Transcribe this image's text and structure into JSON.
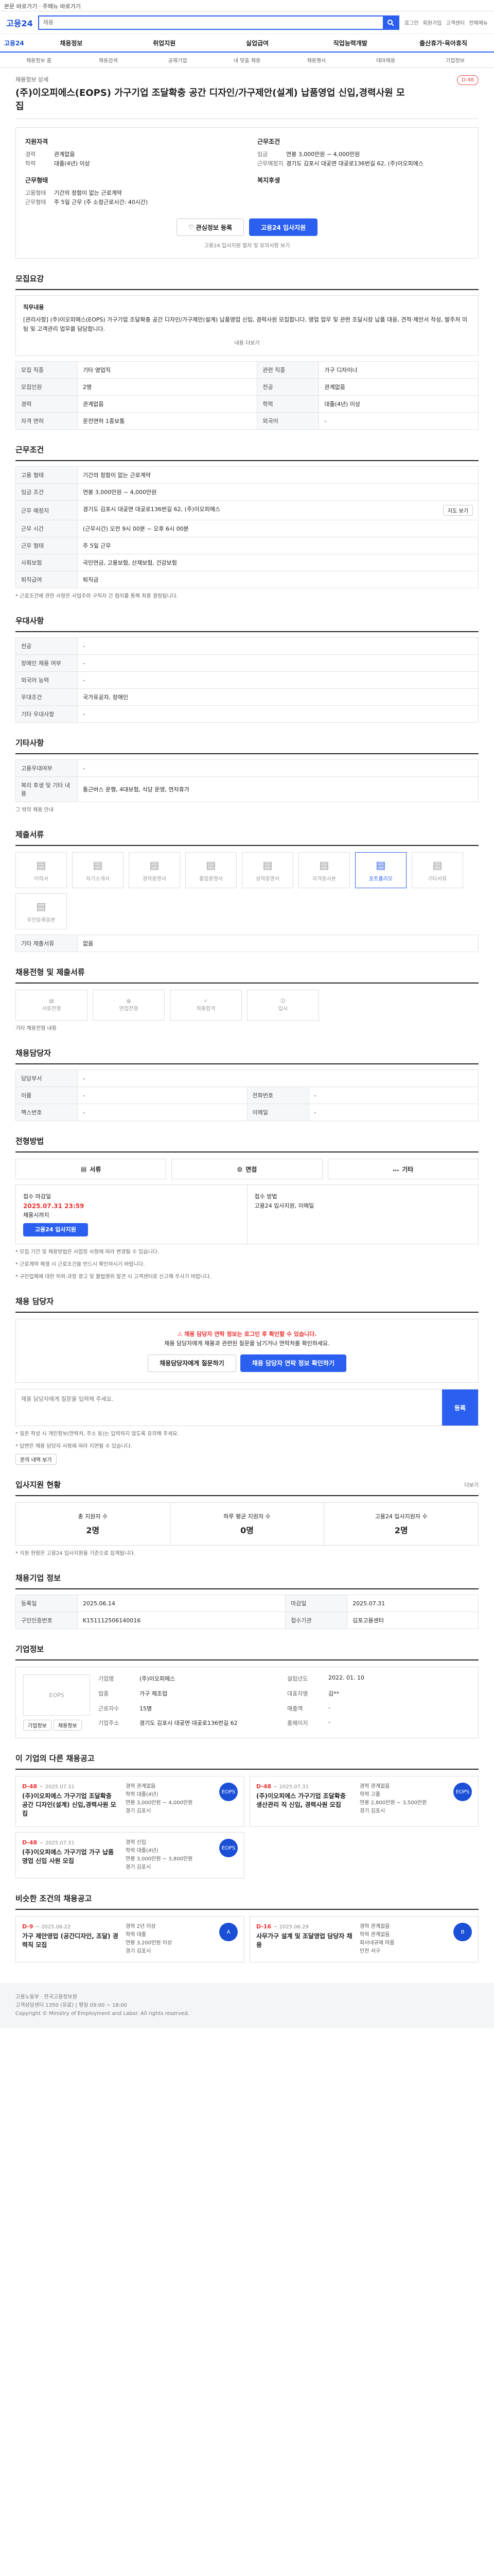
{
  "skip": {
    "a": "본문 바로가기",
    "b": "주메뉴 바로가기"
  },
  "header": {
    "logo": "고용24",
    "search_placeholder": "채용",
    "toplinks": [
      "로그인",
      "회원가입",
      "고객센터",
      "전체메뉴"
    ]
  },
  "gnb": {
    "home": "고용24",
    "items": [
      "채용정보",
      "취업지원",
      "실업급여",
      "직업능력개발",
      "출산휴가·육아휴직"
    ]
  },
  "subnav": [
    "채용정보 홈",
    "채용검색",
    "공채기업",
    "내 맞춤 채용",
    "채용행사",
    "테마채용",
    "기업정보"
  ],
  "title": {
    "category": "채용정보 상세",
    "text": "(주)이오피에스(EOPS) 가구기업 조달확충 공간 디자인/가구제안(설계) 납품영업 신입,경력사원 모집",
    "badge": "D-48"
  },
  "summary": {
    "left_title": "지원자격",
    "left": [
      {
        "k": "경력",
        "v": "관계없음"
      },
      {
        "k": "학력",
        "v": "대졸(4년) 이상"
      }
    ],
    "left2_title": "근무형태",
    "left2": [
      {
        "k": "고용형태",
        "v": "기간의 정함이 없는 근로계약"
      },
      {
        "k": "근무형태",
        "v": "주 5일 근무 (주 소정근로시간: 40시간)"
      }
    ],
    "right_title": "근무조건",
    "right": [
      {
        "k": "임금",
        "v": "연봉 3,000만원 ~ 4,000만원"
      },
      {
        "k": "근무예정지",
        "v": "경기도 김포시 대곶면 대곶로136번길 62, (주)이오피에스"
      }
    ],
    "right2_title": "복지후생",
    "btn_scrap": "관심정보 등록",
    "btn_apply": "고용24 입사지원",
    "note": "고용24 입사지원 절차 및 유의사항 보기"
  },
  "s_recruit": {
    "title": "모집요강",
    "desc_title": "직무내용",
    "desc": "[관리사항] (주)이오피에스(EOPS) 가구기업 조달확충 공간 디자인/가구제안(설계) 납품영업 신입, 경력사원 모집합니다. 영업 업무 및 관련 조달시장 납품 대응, 견적·제안서 작성, 발주처 미팅 및 고객관리 업무를 담당합니다.",
    "fold": "내용 더보기",
    "rows": [
      {
        "k1": "모집 직종",
        "v1": "기타 영업직",
        "k2": "관련 직종",
        "v2": "가구 디자이너"
      },
      {
        "k1": "모집인원",
        "v1": "2명",
        "k2": "전공",
        "v2": "관계없음"
      },
      {
        "k1": "경력",
        "v1": "관계없음",
        "k2": "학력",
        "v2": "대졸(4년) 이상"
      },
      {
        "k1": "자격 면허",
        "v1": "운전면허 1종보통",
        "k2": "외국어",
        "v2": "-"
      }
    ]
  },
  "s_conditions": {
    "title": "근무조건",
    "rows": [
      {
        "k": "고용 형태",
        "v": "기간의 정함이 없는 근로계약"
      },
      {
        "k": "임금 조건",
        "v": "연봉 3,000만원 ~ 4,000만원"
      },
      {
        "k": "근무 예정지",
        "v": "경기도 김포시 대곶면 대곶로136번길 62, (주)이오피에스"
      },
      {
        "k": "근무 시간",
        "v": "(근무시간) 오전 9시 00분 ~ 오후 6시 00분"
      },
      {
        "k": "근무 형태",
        "v": "주 5일 근무"
      },
      {
        "k": "사회보험",
        "v": "국민연금, 고용보험, 산재보험, 건강보험"
      },
      {
        "k": "퇴직급여",
        "v": "퇴직금"
      }
    ],
    "map_btn": "지도 보기",
    "notice": "* 근로조건에 관한 사항은 사업주와 구직자 간 협의를 통해 최종 결정됩니다."
  },
  "s_benefit": {
    "title": "우대사항",
    "rows": [
      {
        "k": "전공",
        "v": "-"
      },
      {
        "k": "장애인 채용 여부",
        "v": "-"
      },
      {
        "k": "외국어 능력",
        "v": "-"
      },
      {
        "k": "우대조건",
        "v": "국가유공자, 장애인"
      },
      {
        "k": "기타 우대사항",
        "v": "-"
      }
    ]
  },
  "s_etc": {
    "title": "기타사항",
    "rows": [
      {
        "k": "고용우대여부",
        "v": "-"
      },
      {
        "k": "복리 후생 및 기타 내용",
        "v": "통근버스 운행, 4대보험, 식당 운영, 연차휴가"
      }
    ],
    "extra": "그 밖의 채용 안내"
  },
  "s_apply_docs": {
    "title": "제출서류",
    "items": [
      {
        "t": "이력서",
        "i": "▤"
      },
      {
        "t": "자기소개서",
        "i": "▤"
      },
      {
        "t": "경력증명서",
        "i": "▤"
      },
      {
        "t": "졸업증명서",
        "i": "▤"
      },
      {
        "t": "성적증명서",
        "i": "▤"
      },
      {
        "t": "자격증사본",
        "i": "▤"
      },
      {
        "t": "포트폴리오",
        "i": "▤"
      },
      {
        "t": "기타서류",
        "i": "▤"
      },
      {
        "t": "주민등록등본",
        "i": "▤"
      }
    ],
    "note": "기타 제출서류",
    "note_v": "없음"
  },
  "s_process": {
    "title": "채용전형 및 제출서류",
    "steps": [
      "서류전형",
      "면접전형",
      "최종합격",
      "입사"
    ],
    "note": "기타 채용전형 내용"
  },
  "s_contact": {
    "title": "채용담당자",
    "rows": [
      {
        "k1": "담당부서",
        "v1": "-",
        "k2": "",
        "v2": ""
      },
      {
        "k1": "이름",
        "v1": "-",
        "k2": "전화번호",
        "v2": "-"
      },
      {
        "k1": "팩스번호",
        "v1": "-",
        "k2": "이메일",
        "v2": "-"
      }
    ]
  },
  "s_method": {
    "title": "전형방법",
    "methods": [
      "서류",
      "면접",
      "기타"
    ],
    "period_label": "접수 마감일",
    "period_v": "2025.07.31 23:59",
    "period_sub": "채용시까지",
    "apply_btn": "고용24 입사지원",
    "method_label": "접수 방법",
    "method_v": "고용24 입사지원, 이메일",
    "notes": [
      "* 모집 기간 및 채용방법은 사업장 사정에 따라 변경될 수 있습니다.",
      "* 근로계약 체결 시 근로조건을 반드시 확인하시기 바랍니다.",
      "* 구인업체에 대한 허위·과장 광고 및 불법행위 발견 시 고객센터로 신고해 주시기 바랍니다."
    ]
  },
  "s_warning": {
    "title": "채용 담당자",
    "warn": "채용 담당자 연락 정보는 로그인 후 확인할 수 있습니다.",
    "sub": "채용 담당자에게 채용과 관련된 질문을 남기거나 연락처를 확인하세요.",
    "btn1": "채용담당자에게 질문하기",
    "btn2": "채용 담당자 연락 정보 확인하기",
    "qa_placeholder": "채용 담당자에게 질문을 입력해 주세요.",
    "qa_send": "등록",
    "notes": [
      "* 질문 작성 시 개인정보(연락처, 주소 등)는 입력하지 않도록 유의해 주세요.",
      "* 답변은 채용 담당자 사정에 따라 지연될 수 있습니다."
    ],
    "more": "문의 내역 보기"
  },
  "s_stats": {
    "title": "입사지원 현황",
    "more": "더보기",
    "items": [
      {
        "l": "총 지원자 수",
        "v": "2명"
      },
      {
        "l": "하루 평균 지원자 수",
        "v": "0명"
      },
      {
        "l": "고용24 입사지원자 수",
        "v": "2명"
      }
    ],
    "note": "* 지원 현황은 고용24 입사지원을 기준으로 집계됩니다."
  },
  "s_info": {
    "title": "채용기업 정보",
    "rows": [
      {
        "k1": "등록일",
        "v1": "2025.06.14",
        "k2": "마감일",
        "v2": "2025.07.31"
      },
      {
        "k1": "구인인증번호",
        "v1": "K151112506140016",
        "k2": "접수기관",
        "v2": "김포고용센터"
      }
    ]
  },
  "s_company": {
    "title": "기업정보",
    "logo": "EOPS",
    "rows": [
      {
        "k": "기업명",
        "v": "(주)이오피에스"
      },
      {
        "k": "설립년도",
        "v": "2022. 01. 10"
      },
      {
        "k": "업종",
        "v": "가구 제조업"
      },
      {
        "k": "대표자명",
        "v": "김**"
      },
      {
        "k": "근로자수",
        "v": "15명"
      },
      {
        "k": "매출액",
        "v": "-"
      },
      {
        "k": "기업주소",
        "v": "경기도 김포시 대곶면 대곶로136번길 62"
      },
      {
        "k": "홈페이지",
        "v": "-"
      }
    ],
    "btn1": "기업정보",
    "btn2": "채용정보"
  },
  "s_jobs1": {
    "title": "이 기업의 다른 채용공고",
    "jobs": [
      {
        "dday": "D-48",
        "date": "~ 2025.07.31",
        "t": "(주)이오피에스 가구기업 조달확충 공간 디자인(설계) 신입,경력사원 모집",
        "m1": "경력 관계없음",
        "m2": "학력 대졸(4년)",
        "m3": "연봉 3,000만원 ~ 4,000만원",
        "m4": "경기 김포시",
        "logo": "EOPS"
      },
      {
        "dday": "D-48",
        "date": "~ 2025.07.31",
        "t": "(주)이오피에스 가구기업 조달확충 생산관리 직 신입, 경력사원 모집",
        "m1": "경력 관계없음",
        "m2": "학력 고졸",
        "m3": "연봉 2,800만원 ~ 3,500만원",
        "m4": "경기 김포시",
        "logo": "EOPS"
      },
      {
        "dday": "D-48",
        "date": "~ 2025.07.31",
        "t": "(주)이오피에스 가구기업 가구 납품영업 신입 사원 모집",
        "m1": "경력 신입",
        "m2": "학력 대졸(4년)",
        "m3": "연봉 3,000만원 ~ 3,800만원",
        "m4": "경기 김포시",
        "logo": "EOPS"
      }
    ]
  },
  "s_jobs2": {
    "title": "비슷한 조건의 채용공고",
    "jobs": [
      {
        "dday": "D-9",
        "date": "~ 2025.06.22",
        "t": "가구 제안영업 (공간디자인, 조달) 경력직 모집",
        "m1": "경력 2년 이상",
        "m2": "학력 대졸",
        "m3": "연봉 3,200만원 이상",
        "m4": "경기 김포시",
        "logo": "A"
      },
      {
        "dday": "D-16",
        "date": "~ 2025.06.29",
        "t": "사무가구 설계 및 조달영업 담당자 채용",
        "m1": "경력 관계없음",
        "m2": "학력 관계없음",
        "m3": "회사내규에 따름",
        "m4": "인천 서구",
        "logo": "B"
      }
    ]
  },
  "footer": {
    "l1": "고용노동부 · 한국고용정보원",
    "l2": "고객상담센터 1350 (유료) | 평일 09:00 ~ 18:00",
    "l3": "Copyright © Ministry of Employment and Labor. All rights reserved."
  }
}
